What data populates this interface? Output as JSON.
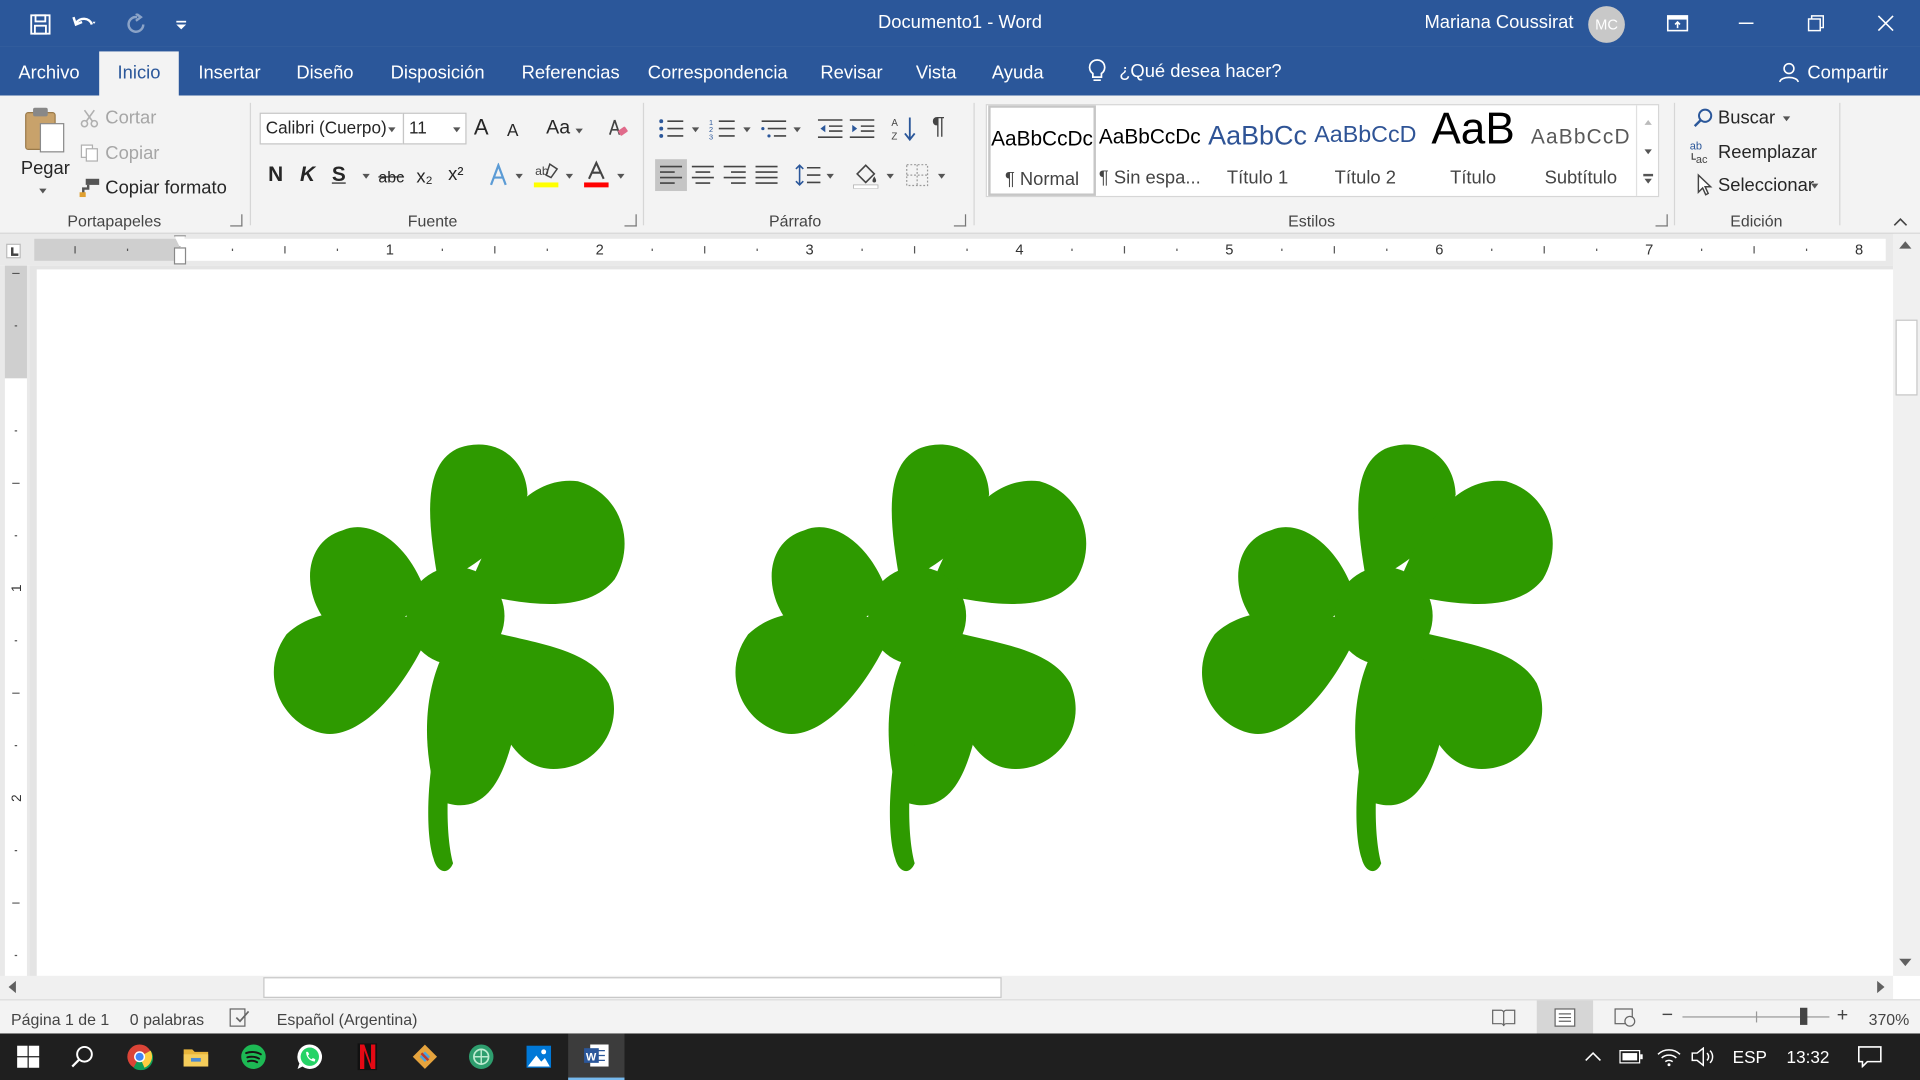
{
  "titlebar": {
    "doc_title": "Documento1  -  Word",
    "user_name": "Mariana Coussirat",
    "user_initials": "MC"
  },
  "tabs": {
    "items": [
      "Archivo",
      "Inicio",
      "Insertar",
      "Diseño",
      "Disposición",
      "Referencias",
      "Correspondencia",
      "Revisar",
      "Vista",
      "Ayuda"
    ],
    "tell_me": "¿Qué desea hacer?",
    "share": "Compartir"
  },
  "clipboard": {
    "paste": "Pegar",
    "cut": "Cortar",
    "copy": "Copiar",
    "format_painter": "Copiar formato",
    "group": "Portapapeles"
  },
  "font": {
    "name": "Calibri (Cuerpo)",
    "size": "11",
    "bold": "N",
    "italic": "K",
    "underline": "S",
    "strike": "abc",
    "sub": "x₂",
    "sup": "x²",
    "change_case": "Aa",
    "grow": "A",
    "shrink": "A",
    "group": "Fuente",
    "highlight_color": "#ffff00",
    "font_color": "#ff0000"
  },
  "paragraph": {
    "group": "Párrafo",
    "pilcrow": "¶"
  },
  "styles": {
    "group": "Estilos",
    "items": [
      {
        "preview": "AaBbCcDc",
        "name": "¶ Normal"
      },
      {
        "preview": "AaBbCcDc",
        "name": "¶ Sin espa..."
      },
      {
        "preview": "AaBbCc",
        "name": "Título 1"
      },
      {
        "preview": "AaBbCcD",
        "name": "Título 2"
      },
      {
        "preview": "AaB",
        "name": "Título"
      },
      {
        "preview": "AaBbCcD",
        "name": "Subtítulo"
      }
    ]
  },
  "editing": {
    "group": "Edición",
    "find": "Buscar",
    "replace": "Reemplazar",
    "select": "Seleccionar"
  },
  "ruler": {
    "numbers": [
      "1",
      "2",
      "3",
      "4",
      "5",
      "6",
      "7",
      "8"
    ],
    "vnumbers": [
      "1",
      "2"
    ]
  },
  "document": {
    "shape": "four-leaf-clover",
    "shape_count": 3,
    "shape_color": "#2e9a00"
  },
  "status": {
    "page": "Página 1 de 1",
    "words": "0 palabras",
    "language": "Español (Argentina)",
    "zoom": "370%"
  },
  "taskbar": {
    "apps": [
      "start-icon",
      "search-icon",
      "chrome-icon",
      "file-explorer-icon",
      "spotify-icon",
      "whatsapp-icon",
      "netflix-icon",
      "git-icon",
      "globe-app-icon",
      "photos-icon",
      "word-icon"
    ],
    "lang": "ESP",
    "time": "13:32"
  },
  "colors": {
    "word_blue": "#2b579a",
    "taskbar": "#1f1f1f"
  }
}
